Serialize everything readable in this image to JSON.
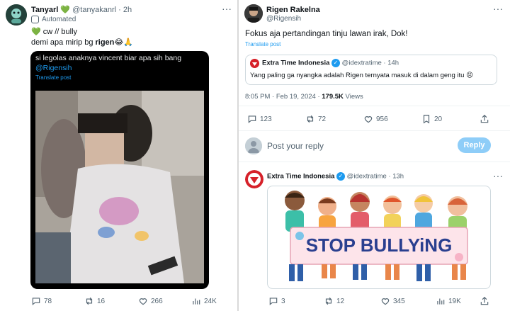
{
  "left_tweet": {
    "display_name": "Tanyarl",
    "name_emoji": "💚",
    "handle": "@tanyakanrl",
    "time": "2h",
    "automated_label": "Automated",
    "line1": "💚 cw // bully",
    "line2_prefix": "demi apa mirip bg ",
    "line2_mention": "rigen",
    "line2_suffix": "😂🙏",
    "media": {
      "caption": "si legolas anaknya vincent biar apa sih bang",
      "caption_mention": "@Rigensih",
      "translate": "Translate post"
    },
    "actions": {
      "replies": "78",
      "reposts": "16",
      "likes": "266",
      "views": "24K"
    }
  },
  "right_tweet": {
    "display_name": "Rigen Rakelna",
    "handle": "@Rigensih",
    "text": "Fokus aja pertandingan tinju lawan irak, Dok!",
    "translate": "Translate post",
    "quote": {
      "display_name": "Extra Time Indonesia",
      "handle": "@idextratime",
      "time": "14h",
      "text": "Yang paling ga nyangka adalah Rigen ternyata masuk di dalam geng itu 😣"
    },
    "timestamp": "8:05 PM · Feb 19, 2024",
    "views_count": "179.5K",
    "views_label": "Views",
    "actions": {
      "replies": "123",
      "reposts": "72",
      "likes": "956",
      "bookmarks": "20"
    },
    "reply_placeholder": "Post your reply",
    "reply_button": "Reply"
  },
  "reply_tweet": {
    "display_name": "Extra Time Indonesia",
    "handle": "@idextratime",
    "time": "13h",
    "banner_text": "STOP BULLYiNG",
    "actions": {
      "replies": "3",
      "reposts": "12",
      "likes": "345",
      "views": "19K"
    }
  },
  "colors": {
    "accent": "#1d9bf0",
    "text": "#0f1419",
    "muted": "#536471",
    "reply_button": "#8ecdf8"
  }
}
